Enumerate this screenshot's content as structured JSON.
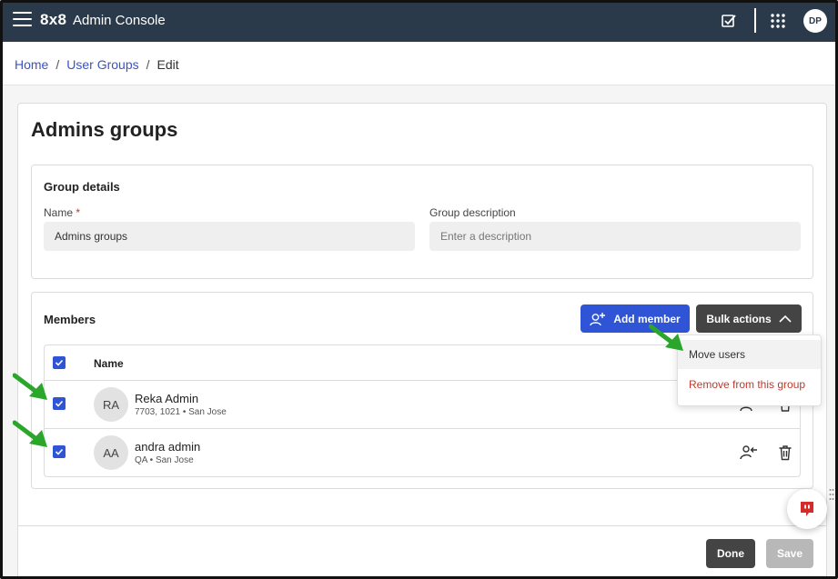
{
  "header": {
    "logo": "8x8",
    "app_title": "Admin Console",
    "user_initials": "DP"
  },
  "breadcrumb": {
    "home": "Home",
    "sep": "/",
    "user_groups": "User Groups",
    "current": "Edit"
  },
  "page": {
    "title": "Admins groups"
  },
  "group_details": {
    "title": "Group details",
    "name_label": "Name",
    "name_required": "*",
    "name_value": "Admins groups",
    "description_label": "Group description",
    "description_placeholder": "Enter a description"
  },
  "members": {
    "title": "Members",
    "add_member_label": "Add member",
    "bulk_actions_label": "Bulk actions",
    "column_name": "Name",
    "rows": [
      {
        "initials": "RA",
        "name": "Reka Admin",
        "meta": "7703, 1021 • San Jose",
        "checked": true
      },
      {
        "initials": "AA",
        "name": "andra admin",
        "meta": "QA • San Jose",
        "checked": true
      }
    ]
  },
  "bulk_menu": {
    "move_users": "Move users",
    "remove_from_group": "Remove from this group"
  },
  "footer": {
    "done_label": "Done",
    "save_label": "Save"
  },
  "colors": {
    "topbar": "#2b3a4a",
    "primary": "#2f54d6",
    "dark_button": "#444444",
    "danger": "#c0392b",
    "annotation_arrow": "#2aa62a"
  }
}
